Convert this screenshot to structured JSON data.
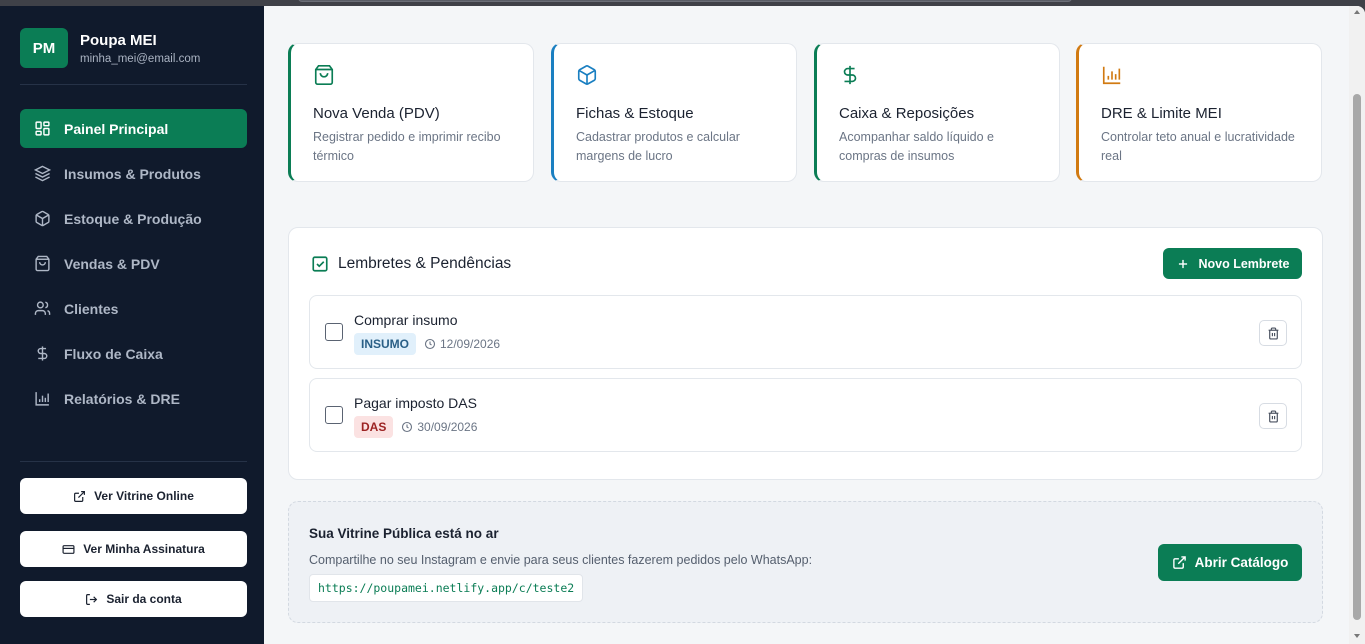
{
  "brand": {
    "initials": "PM",
    "name": "Poupa MEI",
    "email": "minha_mei@email.com"
  },
  "nav": {
    "items": [
      {
        "label": "Painel Principal",
        "icon": "grid-icon",
        "active": true
      },
      {
        "label": "Insumos & Produtos",
        "icon": "layers-icon"
      },
      {
        "label": "Estoque & Produção",
        "icon": "box-icon"
      },
      {
        "label": "Vendas & PDV",
        "icon": "shopping-bag-icon"
      },
      {
        "label": "Clientes",
        "icon": "users-icon"
      },
      {
        "label": "Fluxo de Caixa",
        "icon": "dollar-icon"
      },
      {
        "label": "Relatórios & DRE",
        "icon": "bar-chart-icon"
      }
    ]
  },
  "sidebar_buttons": {
    "storefront": "Ver Vitrine Online",
    "subscription": "Ver Minha Assinatura",
    "logout": "Sair da conta"
  },
  "cards": [
    {
      "title": "Nova Venda (PDV)",
      "desc": "Registrar pedido e imprimir recibo térmico",
      "icon": "shopping-bag-icon",
      "color": "#0b7d55"
    },
    {
      "title": "Fichas & Estoque",
      "desc": "Cadastrar produtos e calcular margens de lucro",
      "icon": "box-icon",
      "color": "#1a7fc1"
    },
    {
      "title": "Caixa & Reposições",
      "desc": "Acompanhar saldo líquido e compras de insumos",
      "icon": "dollar-icon",
      "color": "#0b7d55"
    },
    {
      "title": "DRE & Limite MEI",
      "desc": "Controlar teto anual e lucratividade real",
      "icon": "bar-chart-icon",
      "color": "#d17a12"
    }
  ],
  "reminders": {
    "title": "Lembretes & Pendências",
    "add_label": "Novo Lembrete",
    "items": [
      {
        "title": "Comprar insumo",
        "tag": "INSUMO",
        "date": "12/09/2026"
      },
      {
        "title": "Pagar imposto DAS",
        "tag": "DAS",
        "date": "30/09/2026"
      }
    ]
  },
  "promo": {
    "title": "Sua Vitrine Pública está no ar",
    "desc": "Compartilhe no seu Instagram e envie para seus clientes fazerem pedidos pelo WhatsApp:",
    "url": "https://poupamei.netlify.app/c/teste2",
    "button": "Abrir Catálogo"
  },
  "colors": {
    "accent": "#0b7d55",
    "sidebar_bg": "#101a2c"
  }
}
